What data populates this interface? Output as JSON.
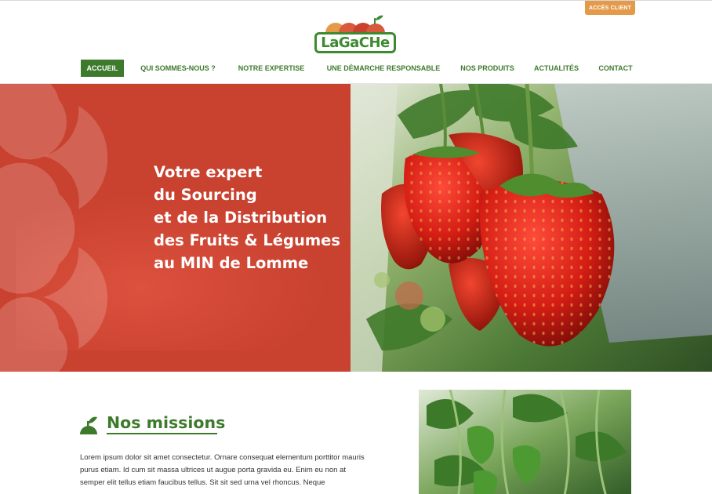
{
  "header": {
    "client_button": "ACCÈS CLIENT",
    "logo_text": "LaGaCHe"
  },
  "nav": {
    "items": [
      {
        "label": "ACCUEIL",
        "active": true
      },
      {
        "label": "QUI SOMMES-NOUS ?",
        "active": false
      },
      {
        "label": "NOTRE EXPERTISE",
        "active": false
      },
      {
        "label": "UNE DÉMARCHE RESPONSABLE",
        "active": false
      },
      {
        "label": "NOS PRODUITS",
        "active": false
      },
      {
        "label": "ACTUALITÉS",
        "active": false
      },
      {
        "label": "CONTACT",
        "active": false
      }
    ]
  },
  "hero": {
    "lines": [
      "Votre expert",
      "du Sourcing",
      "et de la Distribution",
      "des Fruits & Légumes",
      "au MIN de Lomme"
    ]
  },
  "missions": {
    "title": "Nos missions",
    "text": "Lorem ipsum dolor sit amet consectetur. Ornare consequat elementum porttitor mauris purus etiam. Id cum sit massa ultrices ut augue porta gravida eu. Enim eu non at semper elit tellus etiam faucibus tellus. Sit sit sed urna vel rhoncus. Neque"
  },
  "colors": {
    "brand_green": "#3d7a2c",
    "hero_red": "#c9412f",
    "client_orange": "#e39a4a"
  }
}
